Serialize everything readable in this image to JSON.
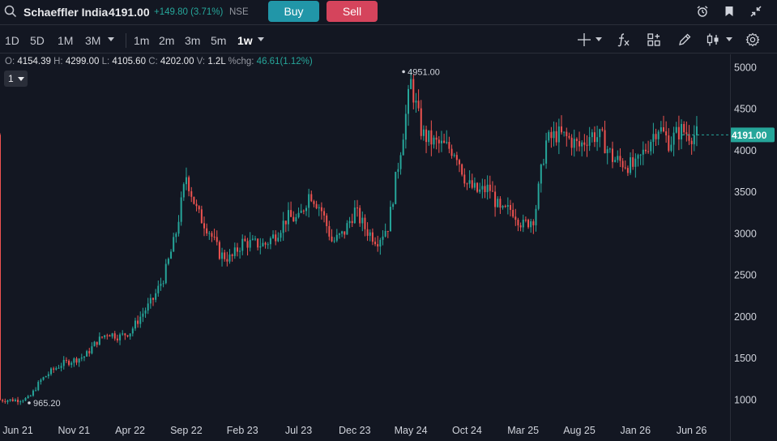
{
  "header": {
    "symbol": "Schaeffler India",
    "price": "4191.00",
    "change": "+149.80 (3.71%)",
    "exchange": "NSE",
    "buy_label": "Buy",
    "sell_label": "Sell",
    "icons": [
      "search-icon",
      "alarm-clock-icon",
      "bookmark-icon",
      "collapse-icon"
    ]
  },
  "toolbar": {
    "ranges": [
      "1D",
      "5D",
      "1M",
      "3M"
    ],
    "intervals": [
      "1m",
      "2m",
      "3m",
      "5m",
      "1w"
    ],
    "active_interval": "1w",
    "tools": [
      "crosshair-icon",
      "indicators-fx-icon",
      "templates-icon",
      "drawing-pen-icon",
      "candle-style-icon",
      "settings-gear-icon"
    ]
  },
  "ohlc": {
    "open_label": "O:",
    "open": "4154.39",
    "high_label": "H:",
    "high": "4299.00",
    "low_label": "L:",
    "low": "4105.60",
    "close_label": "C:",
    "close": "4202.00",
    "volume_label": "V:",
    "volume": "1.2L",
    "chg_label": "%chg:",
    "chg": "46.61(1.12%)"
  },
  "layout_select": "1",
  "colors": {
    "up": "#26a69a",
    "down": "#ef5350",
    "background": "#131722",
    "price_tag": "#26a69a"
  },
  "chart_data": {
    "type": "candlestick",
    "interval": "1w",
    "x_ticks": [
      "Jun 21",
      "Nov 21",
      "Apr 22",
      "Sep 22",
      "Feb 23",
      "Jul 23",
      "Dec 23",
      "May 24",
      "Oct 24",
      "Mar 25",
      "Aug 25",
      "Jan 26",
      "Jun 26"
    ],
    "y_ticks": [
      1000,
      1500,
      2000,
      2500,
      3000,
      3500,
      4000,
      4500,
      5000
    ],
    "ylim": [
      770,
      5160
    ],
    "last_price": 4191.0,
    "last_price_label": "4191.00",
    "annotations": [
      {
        "label": "4951.00",
        "x": "May 24",
        "value": 4951.0
      },
      {
        "label": "965.20",
        "x": "Jun 21",
        "value": 965.2
      }
    ],
    "close_path": [
      [
        "Jun 21",
        1000
      ],
      [
        "Jul 21",
        1020
      ],
      [
        "Aug 21",
        1230
      ],
      [
        "Sep 21",
        1350
      ],
      [
        "Oct 21",
        1440
      ],
      [
        "Nov 21",
        1480
      ],
      [
        "Dec 21",
        1530
      ],
      [
        "Jan 22",
        1700
      ],
      [
        "Feb 22",
        1810
      ],
      [
        "Mar 22",
        1760
      ],
      [
        "Apr 22",
        1820
      ],
      [
        "May 22",
        2020
      ],
      [
        "Jun 22",
        2200
      ],
      [
        "Jul 22",
        2480
      ],
      [
        "Aug 22",
        2950
      ],
      [
        "Sep 22",
        3700
      ],
      [
        "Oct 22",
        3250
      ],
      [
        "Nov 22",
        3050
      ],
      [
        "Dec 22",
        2750
      ],
      [
        "Jan 23",
        2700
      ],
      [
        "Feb 23",
        2900
      ],
      [
        "Mar 23",
        2880
      ],
      [
        "Apr 23",
        2870
      ],
      [
        "May 23",
        3000
      ],
      [
        "Jun 23",
        3200
      ],
      [
        "Jul 23",
        3170
      ],
      [
        "Aug 23",
        3500
      ],
      [
        "Sep 23",
        3300
      ],
      [
        "Oct 23",
        2900
      ],
      [
        "Nov 23",
        3000
      ],
      [
        "Dec 23",
        3280
      ],
      [
        "Jan 24",
        3050
      ],
      [
        "Feb 24",
        2920
      ],
      [
        "Mar 24",
        3100
      ],
      [
        "Apr 24",
        3950
      ],
      [
        "May 24",
        4820
      ],
      [
        "Jun 24",
        4200
      ],
      [
        "Jul 24",
        4100
      ],
      [
        "Aug 24",
        4050
      ],
      [
        "Sep 24",
        4000
      ],
      [
        "Oct 24",
        3600
      ],
      [
        "Nov 24",
        3500
      ],
      [
        "Dec 24",
        3550
      ],
      [
        "Jan 25",
        3250
      ],
      [
        "Feb 25",
        3300
      ],
      [
        "Mar 25",
        3100
      ],
      [
        "Apr 25",
        3200
      ],
      [
        "May 25",
        4100
      ],
      [
        "Jun 25",
        4200
      ],
      [
        "Jul 25",
        4150
      ],
      [
        "Aug 25",
        4050
      ],
      [
        "Sep 25",
        4200
      ],
      [
        "Oct 25",
        4150
      ],
      [
        "Nov 25",
        3900
      ],
      [
        "Dec 25",
        3850
      ],
      [
        "Jan 26",
        3800
      ],
      [
        "Feb 26",
        4050
      ],
      [
        "Mar 26",
        4300
      ],
      [
        "Apr 26",
        4100
      ],
      [
        "May 26",
        4250
      ],
      [
        "Jun 26",
        4191
      ]
    ]
  }
}
